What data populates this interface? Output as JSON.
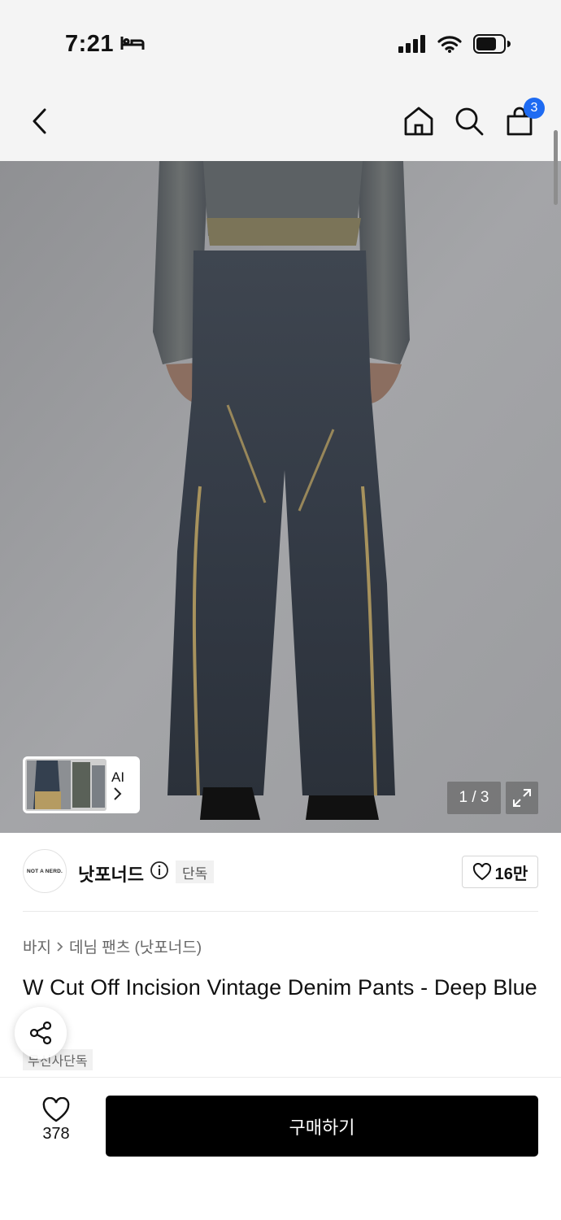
{
  "status_bar": {
    "time": "7:21",
    "icons": [
      "bed-icon",
      "signal-icon",
      "wifi-icon",
      "battery-icon"
    ]
  },
  "nav": {
    "icons": [
      "back-icon",
      "home-icon",
      "search-icon",
      "cart-icon"
    ],
    "cart_count": "3"
  },
  "gallery": {
    "thumb_label": "AI",
    "counter": "1 / 3"
  },
  "brand": {
    "logo_text": "NOT A NERD.",
    "name": "낫포너드",
    "tag": "단독",
    "likes": "16만"
  },
  "breadcrumb": {
    "category": "바지",
    "subcategory": "데님 팬츠 (낫포너드)"
  },
  "product": {
    "title": "W Cut Off Incision Vintage Denim Pants - Deep Blue",
    "exclusive_tag": "무신사단독"
  },
  "bottom_bar": {
    "wish_count": "378",
    "buy_label": "구매하기"
  },
  "colors": {
    "accent": "#1e6bf2",
    "buy_button": "#000000"
  }
}
